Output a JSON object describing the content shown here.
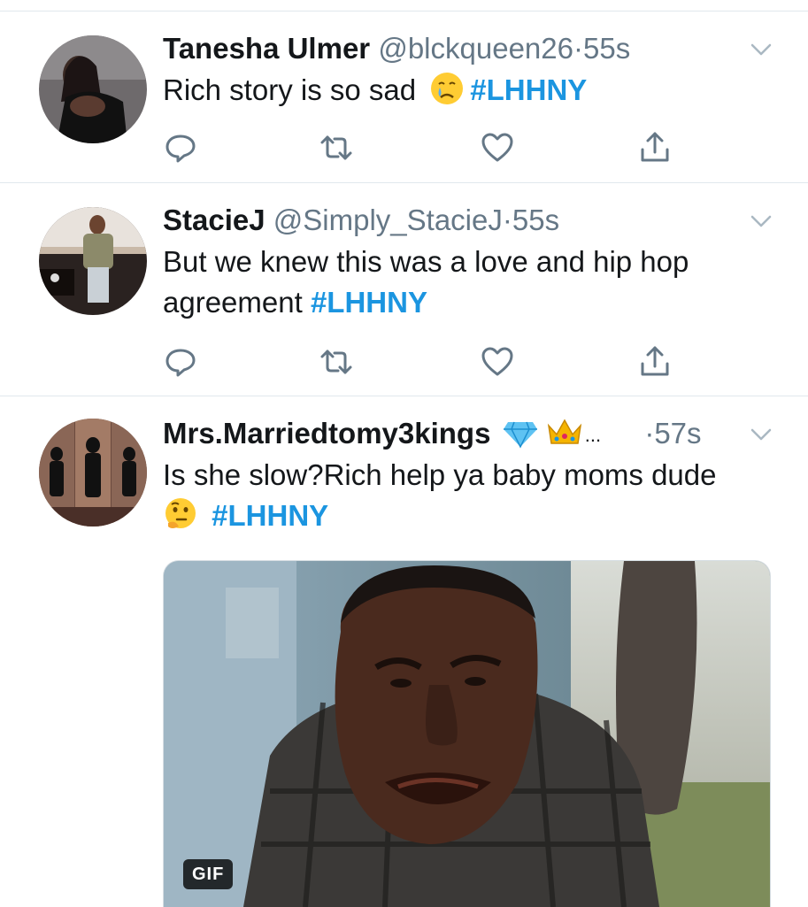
{
  "tweets": [
    {
      "name": "Tanesha Ulmer",
      "handle": "@blckqueen26",
      "separator": "·",
      "time": "55s",
      "text": "Rich story is so sad",
      "emoji": "crying-face",
      "hashtag": "#LHHNY"
    },
    {
      "name": "StacieJ",
      "handle": "@Simply_StacieJ",
      "separator": "·",
      "time": "55s",
      "text_line1": "But we knew this was a love and hip hop",
      "text_line2": "agreement",
      "hashtag": "#LHHNY"
    },
    {
      "name": "Mrs.Marriedtomy3kings",
      "name_badges": [
        "gem-emoji",
        "crown-emoji"
      ],
      "ellipsis": "...",
      "separator": "·",
      "time": "57s",
      "text_line1": "Is she slow?Rich help ya baby moms dude",
      "emoji": "thinking-face",
      "hashtag": "#LHHNY",
      "media": {
        "type": "gif",
        "badge": "GIF"
      }
    }
  ],
  "action_icons": [
    "reply-icon",
    "retweet-icon",
    "like-icon",
    "share-icon"
  ],
  "colors": {
    "link": "#1b95e0",
    "secondary": "#657786",
    "divider": "#e1e8ed",
    "text": "#14171a"
  }
}
